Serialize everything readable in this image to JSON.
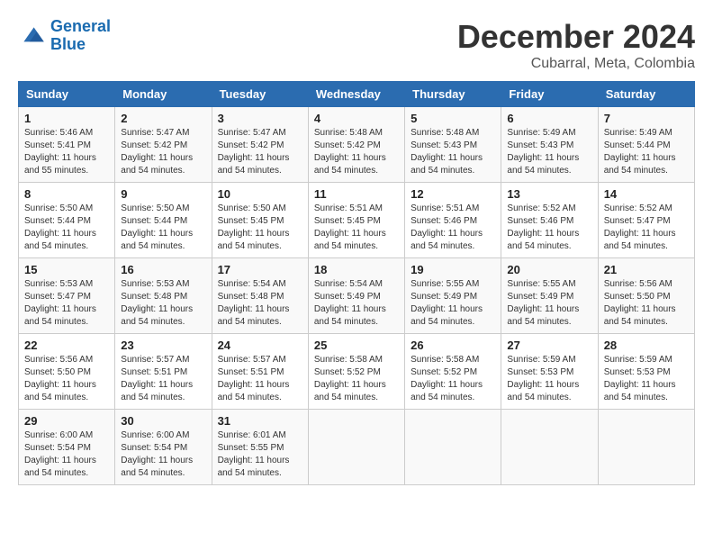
{
  "logo": {
    "line1": "General",
    "line2": "Blue"
  },
  "title": "December 2024",
  "subtitle": "Cubarral, Meta, Colombia",
  "days_of_week": [
    "Sunday",
    "Monday",
    "Tuesday",
    "Wednesday",
    "Thursday",
    "Friday",
    "Saturday"
  ],
  "weeks": [
    [
      {
        "day": "1",
        "sunrise": "5:46 AM",
        "sunset": "5:41 PM",
        "daylight": "11 hours and 55 minutes."
      },
      {
        "day": "2",
        "sunrise": "5:47 AM",
        "sunset": "5:42 PM",
        "daylight": "11 hours and 54 minutes."
      },
      {
        "day": "3",
        "sunrise": "5:47 AM",
        "sunset": "5:42 PM",
        "daylight": "11 hours and 54 minutes."
      },
      {
        "day": "4",
        "sunrise": "5:48 AM",
        "sunset": "5:42 PM",
        "daylight": "11 hours and 54 minutes."
      },
      {
        "day": "5",
        "sunrise": "5:48 AM",
        "sunset": "5:43 PM",
        "daylight": "11 hours and 54 minutes."
      },
      {
        "day": "6",
        "sunrise": "5:49 AM",
        "sunset": "5:43 PM",
        "daylight": "11 hours and 54 minutes."
      },
      {
        "day": "7",
        "sunrise": "5:49 AM",
        "sunset": "5:44 PM",
        "daylight": "11 hours and 54 minutes."
      }
    ],
    [
      {
        "day": "8",
        "sunrise": "5:50 AM",
        "sunset": "5:44 PM",
        "daylight": "11 hours and 54 minutes."
      },
      {
        "day": "9",
        "sunrise": "5:50 AM",
        "sunset": "5:44 PM",
        "daylight": "11 hours and 54 minutes."
      },
      {
        "day": "10",
        "sunrise": "5:50 AM",
        "sunset": "5:45 PM",
        "daylight": "11 hours and 54 minutes."
      },
      {
        "day": "11",
        "sunrise": "5:51 AM",
        "sunset": "5:45 PM",
        "daylight": "11 hours and 54 minutes."
      },
      {
        "day": "12",
        "sunrise": "5:51 AM",
        "sunset": "5:46 PM",
        "daylight": "11 hours and 54 minutes."
      },
      {
        "day": "13",
        "sunrise": "5:52 AM",
        "sunset": "5:46 PM",
        "daylight": "11 hours and 54 minutes."
      },
      {
        "day": "14",
        "sunrise": "5:52 AM",
        "sunset": "5:47 PM",
        "daylight": "11 hours and 54 minutes."
      }
    ],
    [
      {
        "day": "15",
        "sunrise": "5:53 AM",
        "sunset": "5:47 PM",
        "daylight": "11 hours and 54 minutes."
      },
      {
        "day": "16",
        "sunrise": "5:53 AM",
        "sunset": "5:48 PM",
        "daylight": "11 hours and 54 minutes."
      },
      {
        "day": "17",
        "sunrise": "5:54 AM",
        "sunset": "5:48 PM",
        "daylight": "11 hours and 54 minutes."
      },
      {
        "day": "18",
        "sunrise": "5:54 AM",
        "sunset": "5:49 PM",
        "daylight": "11 hours and 54 minutes."
      },
      {
        "day": "19",
        "sunrise": "5:55 AM",
        "sunset": "5:49 PM",
        "daylight": "11 hours and 54 minutes."
      },
      {
        "day": "20",
        "sunrise": "5:55 AM",
        "sunset": "5:49 PM",
        "daylight": "11 hours and 54 minutes."
      },
      {
        "day": "21",
        "sunrise": "5:56 AM",
        "sunset": "5:50 PM",
        "daylight": "11 hours and 54 minutes."
      }
    ],
    [
      {
        "day": "22",
        "sunrise": "5:56 AM",
        "sunset": "5:50 PM",
        "daylight": "11 hours and 54 minutes."
      },
      {
        "day": "23",
        "sunrise": "5:57 AM",
        "sunset": "5:51 PM",
        "daylight": "11 hours and 54 minutes."
      },
      {
        "day": "24",
        "sunrise": "5:57 AM",
        "sunset": "5:51 PM",
        "daylight": "11 hours and 54 minutes."
      },
      {
        "day": "25",
        "sunrise": "5:58 AM",
        "sunset": "5:52 PM",
        "daylight": "11 hours and 54 minutes."
      },
      {
        "day": "26",
        "sunrise": "5:58 AM",
        "sunset": "5:52 PM",
        "daylight": "11 hours and 54 minutes."
      },
      {
        "day": "27",
        "sunrise": "5:59 AM",
        "sunset": "5:53 PM",
        "daylight": "11 hours and 54 minutes."
      },
      {
        "day": "28",
        "sunrise": "5:59 AM",
        "sunset": "5:53 PM",
        "daylight": "11 hours and 54 minutes."
      }
    ],
    [
      {
        "day": "29",
        "sunrise": "6:00 AM",
        "sunset": "5:54 PM",
        "daylight": "11 hours and 54 minutes."
      },
      {
        "day": "30",
        "sunrise": "6:00 AM",
        "sunset": "5:54 PM",
        "daylight": "11 hours and 54 minutes."
      },
      {
        "day": "31",
        "sunrise": "6:01 AM",
        "sunset": "5:55 PM",
        "daylight": "11 hours and 54 minutes."
      },
      null,
      null,
      null,
      null
    ]
  ]
}
